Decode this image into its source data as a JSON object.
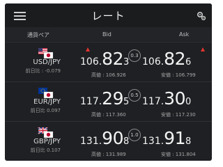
{
  "header": {
    "title": "レート"
  },
  "columns": {
    "pair": "通貨ペア",
    "bid": "Bid",
    "ask": "Ask"
  },
  "rows": [
    {
      "pair": "USD/JPY",
      "change": "前日比 : -0.079",
      "bid": {
        "small": "106.",
        "large": "82",
        "pip": "3"
      },
      "bid_sub": "高値 : 106.926",
      "spread": "0.3",
      "ask": {
        "small": "106.",
        "large": "82",
        "pip": "6"
      },
      "ask_sub": "安値 : 106.799",
      "bid_up": true,
      "ask_up": true
    },
    {
      "pair": "EUR/JPY",
      "change": "前日比 0.097",
      "bid": {
        "small": "117.",
        "large": "29",
        "pip": "5"
      },
      "bid_sub": "高値 : 117.360",
      "spread": "0.5",
      "ask": {
        "small": "117.",
        "large": "30",
        "pip": "0"
      },
      "ask_sub": "安値 : 117.230",
      "bid_up": false,
      "ask_up": false
    },
    {
      "pair": "GBP/JPY",
      "change": "前日比 0.107",
      "bid": {
        "small": "131.",
        "large": "90",
        "pip": "8"
      },
      "bid_sub": "高値 : 131.989",
      "spread": "1.0",
      "ask": {
        "small": "131.",
        "large": "91",
        "pip": "8"
      },
      "ask_sub": "安値 : 131.804",
      "bid_up": false,
      "ask_up": false
    }
  ],
  "colors": {
    "background": "#1e2023",
    "up": "#e2342f",
    "text": "#f3f3f3"
  },
  "icons": {
    "menu": "hamburger-menu-icon",
    "settings": "gear-icon"
  }
}
